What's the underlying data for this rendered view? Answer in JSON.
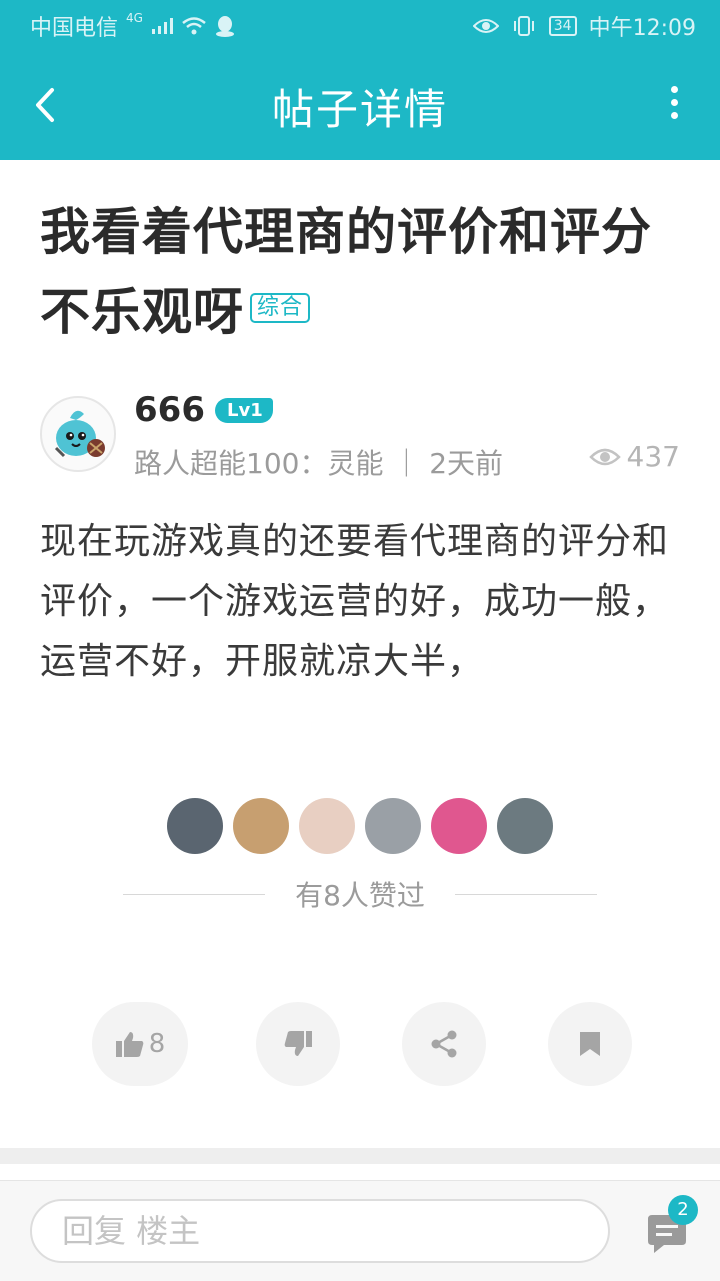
{
  "status_bar": {
    "carrier": "中国电信",
    "network": "4G",
    "battery": "34",
    "time": "中午12:09"
  },
  "header": {
    "title": "帖子详情"
  },
  "post": {
    "title": "我看着代理商的评价和评分不乐观呀",
    "tag": "综合",
    "author": "666",
    "level": "Lv1",
    "author_meta": "路人超能100：灵能 ｜ 2天前",
    "views": "437",
    "content": "现在玩游戏真的还要看代理商的评分和评价，一个游戏运营的好，成功一般，运营不好，开服就凉大半，"
  },
  "likes": {
    "text": "有8人赞过",
    "count": "8",
    "avatars": [
      "#5a6570",
      "#c79f70",
      "#e8cfc2",
      "#9aa0a6",
      "#e0578f",
      "#6c7a80"
    ]
  },
  "reply_bar": {
    "placeholder": "回复  楼主",
    "comment_count": "2"
  },
  "colors": {
    "accent": "#1db8c6"
  }
}
